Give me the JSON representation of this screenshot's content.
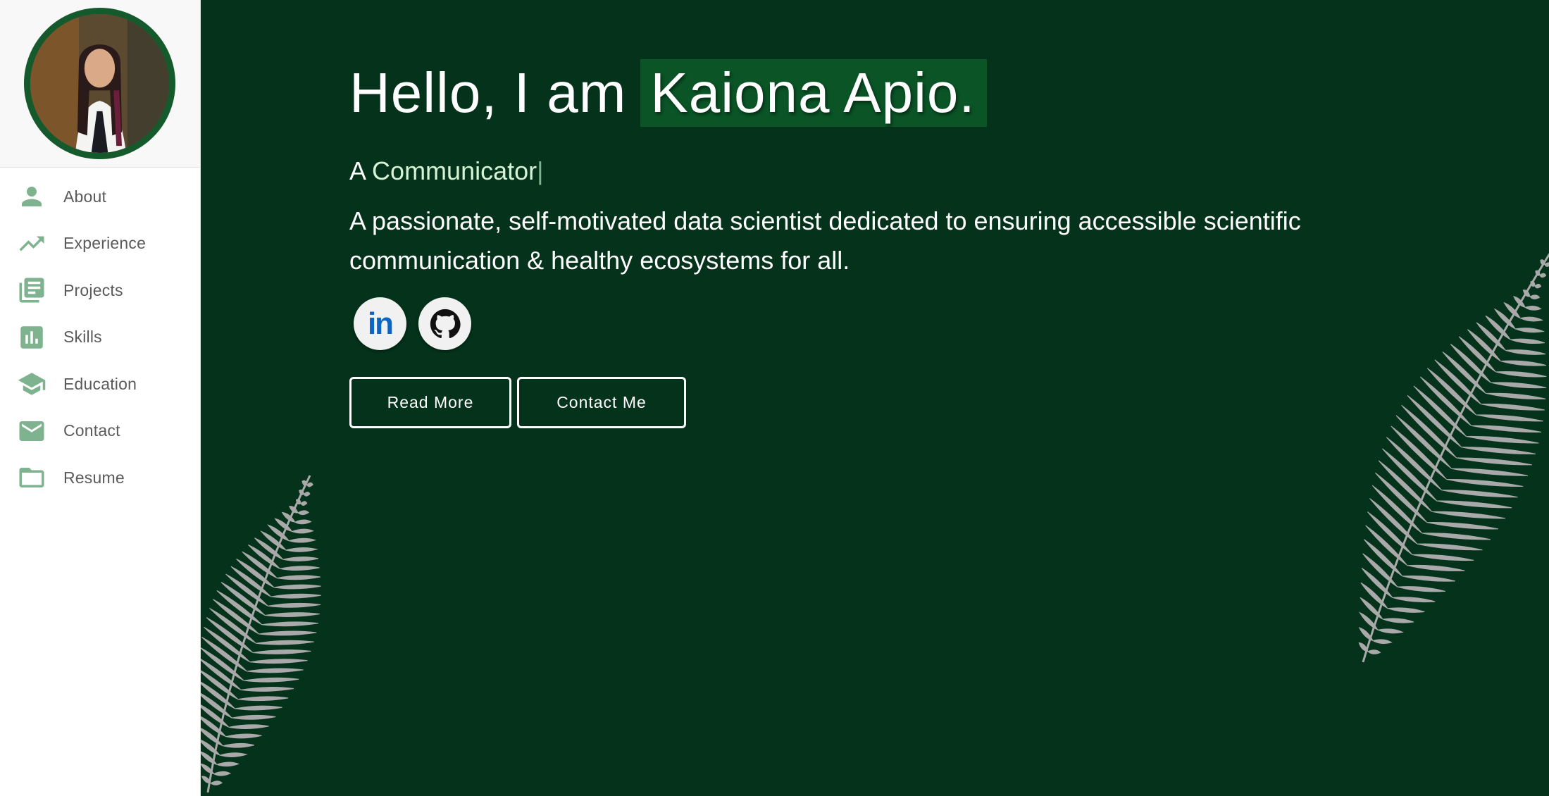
{
  "sidebar": {
    "avatar_alt": "Kaiona Apio",
    "items": [
      {
        "label": "About",
        "icon": "person-icon"
      },
      {
        "label": "Experience",
        "icon": "trending-up-icon"
      },
      {
        "label": "Projects",
        "icon": "library-books-icon"
      },
      {
        "label": "Skills",
        "icon": "bar-chart-icon"
      },
      {
        "label": "Education",
        "icon": "graduation-cap-icon"
      },
      {
        "label": "Contact",
        "icon": "mail-icon"
      },
      {
        "label": "Resume",
        "icon": "folder-icon"
      }
    ]
  },
  "hero": {
    "greeting": "Hello, I am",
    "name": "Kaiona Apio.",
    "role_prefix": "A",
    "role_typed": "Communicator",
    "role_cursor": "|",
    "tagline": "A passionate, self-motivated data scientist dedicated to ensuring accessible scientific communication & healthy ecosystems for all."
  },
  "socials": {
    "linkedin_label": "in",
    "linkedin_icon": "linkedin-icon",
    "github_icon": "github-icon"
  },
  "buttons": {
    "read_more": "Read More",
    "contact_me": "Contact Me"
  },
  "colors": {
    "background": "#04321a",
    "name_highlight": "#0a5426",
    "avatar_ring": "#145a2d",
    "nav_icon": "#7fb38f",
    "linkedin_blue": "#0a66c2"
  }
}
